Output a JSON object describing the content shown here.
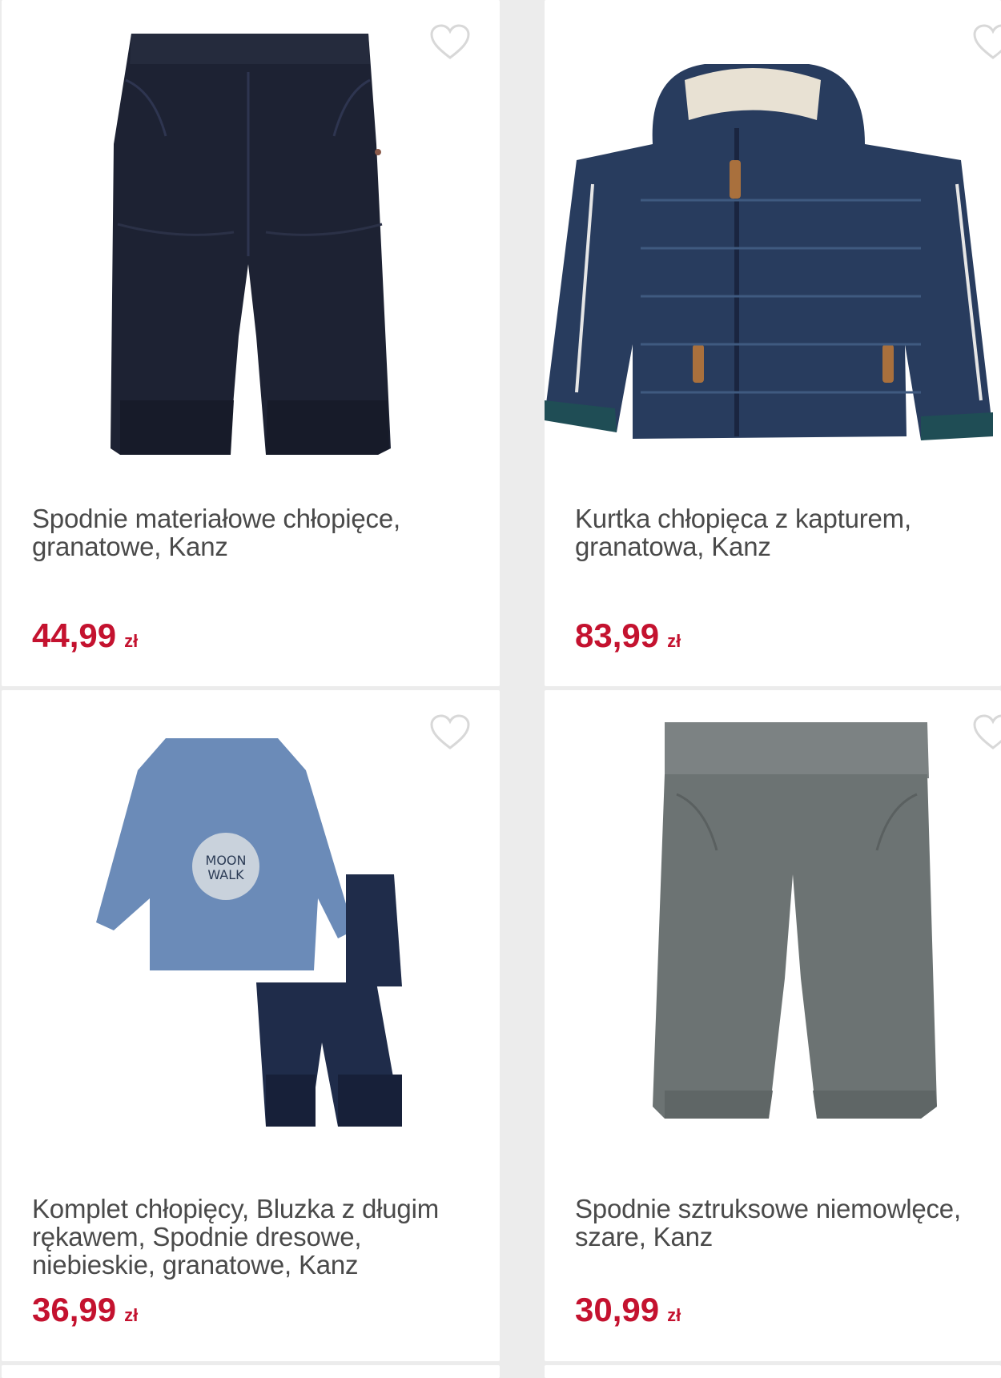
{
  "colors": {
    "accent": "#c4122f",
    "text": "#4a4a4a",
    "heart": "#d8d8d8"
  },
  "products": [
    {
      "title": "Spodnie materiałowe chłopięce, granatowe, Kanz",
      "price": "44,99",
      "currency": "zł",
      "icon": "heart-icon"
    },
    {
      "title": "Kurtka chłopięca z kapturem, granatowa, Kanz",
      "price": "83,99",
      "currency": "zł",
      "icon": "heart-icon"
    },
    {
      "title": "Komplet chłopięcy, Bluzka z długim rękawem, Spodnie dresowe, niebieskie, granatowe, Kanz",
      "price": "36,99",
      "currency": "zł",
      "icon": "heart-icon"
    },
    {
      "title": "Spodnie sztruksowe niemowlęce, szare, Kanz",
      "price": "30,99",
      "currency": "zł",
      "icon": "heart-icon"
    }
  ]
}
